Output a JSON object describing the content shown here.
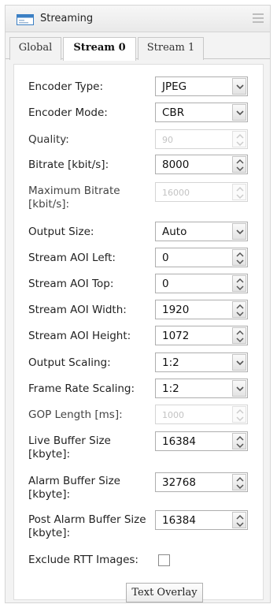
{
  "panel": {
    "title": "Streaming",
    "title_icon": "monitor-icon"
  },
  "tabs": [
    {
      "label": "Global",
      "active": false
    },
    {
      "label": "Stream 0",
      "active": true
    },
    {
      "label": "Stream 1",
      "active": false
    }
  ],
  "fields": {
    "encoder_type": {
      "label": "Encoder Type:",
      "value": "JPEG"
    },
    "encoder_mode": {
      "label": "Encoder Mode:",
      "value": "CBR"
    },
    "quality": {
      "label": "Quality:",
      "value": "90"
    },
    "bitrate": {
      "label": "Bitrate [kbit/s]:",
      "value": "8000"
    },
    "max_bitrate": {
      "label": "Maximum Bitrate\n[kbit/s]:",
      "value": "16000"
    },
    "output_size": {
      "label": "Output Size:",
      "value": "Auto"
    },
    "aoi_left": {
      "label": "Stream AOI Left:",
      "value": "0"
    },
    "aoi_top": {
      "label": "Stream AOI Top:",
      "value": "0"
    },
    "aoi_width": {
      "label": "Stream AOI Width:",
      "value": "1920"
    },
    "aoi_height": {
      "label": "Stream AOI Height:",
      "value": "1072"
    },
    "output_scaling": {
      "label": "Output Scaling:",
      "value": "1:2"
    },
    "frame_rate_scaling": {
      "label": "Frame Rate Scaling:",
      "value": "1:2"
    },
    "gop_length": {
      "label": "GOP Length [ms]:",
      "value": "1000"
    },
    "live_buffer": {
      "label": "Live Buffer Size\n[kbyte]:",
      "value": "16384"
    },
    "alarm_buffer": {
      "label": "Alarm Buffer Size\n[kbyte]:",
      "value": "32768"
    },
    "post_alarm_buffer": {
      "label": "Post Alarm Buffer Size\n[kbyte]:",
      "value": "16384"
    },
    "exclude_rtt": {
      "label": "Exclude RTT Images:",
      "checked": false
    }
  },
  "buttons": {
    "text_overlay": "Text Overlay"
  }
}
